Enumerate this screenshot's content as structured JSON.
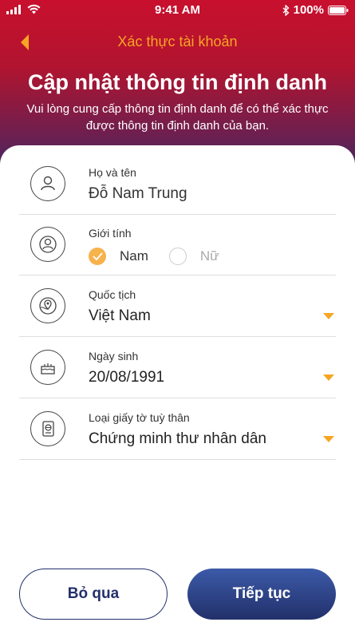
{
  "status_bar": {
    "time": "9:41 AM",
    "battery": "100%"
  },
  "nav": {
    "title": "Xác thực tài khoản"
  },
  "header": {
    "headline": "Cập nhật thông tin định danh",
    "subtitle": "Vui lòng cung cấp thông tin định danh để có thể xác thực được thông tin định danh của bạn."
  },
  "form": {
    "full_name": {
      "label": "Họ và tên",
      "value": "Đỗ Nam Trung",
      "icon": "person-icon"
    },
    "gender": {
      "label": "Giới tính",
      "icon": "person-circle-icon",
      "options": [
        {
          "label": "Nam",
          "selected": true
        },
        {
          "label": "Nữ",
          "selected": false
        }
      ]
    },
    "nationality": {
      "label": "Quốc tịch",
      "value": "Việt Nam",
      "icon": "globe-pin-icon"
    },
    "birthday": {
      "label": "Ngày sinh",
      "value": "20/08/1991",
      "icon": "cake-icon"
    },
    "id_type": {
      "label": "Loại giấy tờ tuỳ thân",
      "value": "Chứng minh thư nhân dân",
      "icon": "passport-icon"
    }
  },
  "buttons": {
    "skip": "Bỏ qua",
    "next": "Tiếp tục"
  },
  "colors": {
    "brand_red": "#c8102e",
    "accent_orange": "#f6a623",
    "navy": "#23306b",
    "checked": "#f6b24b"
  }
}
